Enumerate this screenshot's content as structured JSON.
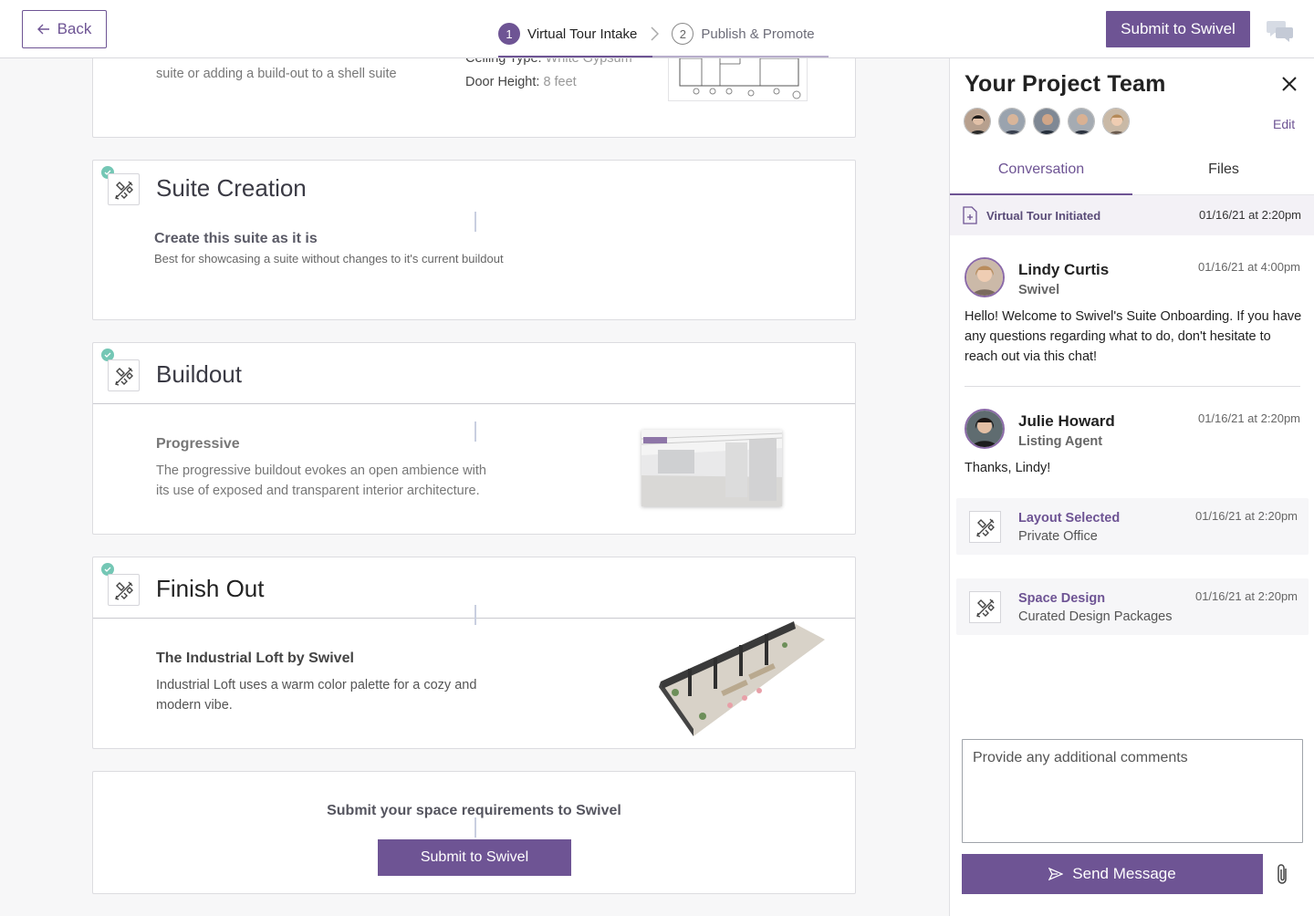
{
  "header": {
    "back_label": "Back",
    "steps": [
      {
        "num": "1",
        "label": "Virtual Tour Intake"
      },
      {
        "num": "2",
        "label": "Publish & Promote"
      }
    ],
    "submit_label": "Submit to Swivel"
  },
  "main": {
    "top_card": {
      "desc_line": "suite or adding a build-out to a shell suite",
      "ceiling_label": "Ceiling Type:",
      "ceiling_value": "White Gypsum",
      "door_label": "Door Height:",
      "door_value": "8 feet"
    },
    "suite_creation": {
      "title": "Suite Creation",
      "subtitle": "Create this suite as it is",
      "desc": "Best for showcasing a suite without changes to it's current buildout"
    },
    "buildout": {
      "title": "Buildout",
      "subtitle": "Progressive",
      "desc": "The progressive buildout evokes an open ambience with its use of exposed and transparent interior architecture."
    },
    "finish_out": {
      "title": "Finish Out",
      "subtitle": "The Industrial Loft by Swivel",
      "desc": "Industrial Loft uses a warm color palette for a cozy and modern vibe."
    },
    "submit_card": {
      "prompt": "Submit your space requirements to Swivel",
      "button": "Submit to Swivel"
    }
  },
  "panel": {
    "title": "Your Project Team",
    "edit_label": "Edit",
    "tabs": [
      "Conversation",
      "Files"
    ],
    "event": {
      "label": "Virtual Tour Initiated",
      "time": "01/16/21 at 2:20pm"
    },
    "messages": [
      {
        "name": "Lindy Curtis",
        "role": "Swivel",
        "time": "01/16/21 at 4:00pm",
        "body": "Hello! Welcome to Swivel's Suite Onboarding. If you have any questions regarding what to do, don't hesitate to reach out via this chat!"
      },
      {
        "name": "Julie Howard",
        "role": "Listing Agent",
        "time": "01/16/21 at 2:20pm",
        "body": "Thanks, Lindy!"
      }
    ],
    "activities": [
      {
        "title": "Layout Selected",
        "sub": "Private Office",
        "time": "01/16/21 at 2:20pm"
      },
      {
        "title": "Space Design",
        "sub": "Curated Design Packages",
        "time": "01/16/21 at 2:20pm"
      }
    ],
    "comment_placeholder": "Provide any additional comments",
    "send_label": "Send Message"
  },
  "colors": {
    "accent": "#6e5494",
    "check": "#74c7b5"
  }
}
